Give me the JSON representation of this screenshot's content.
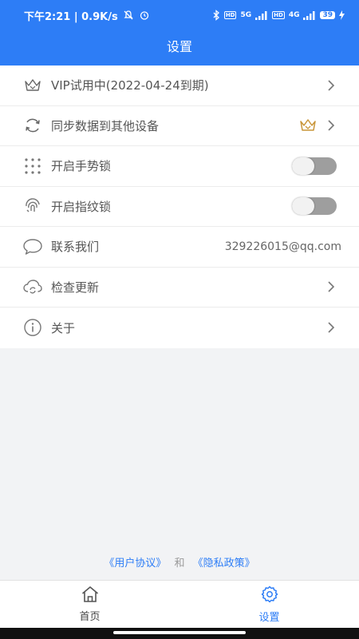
{
  "status_bar": {
    "time_speed": "下午2:21 | 0.9K/s",
    "battery": "39",
    "net1": "5G",
    "net2": "4G",
    "hd": "HD"
  },
  "header": {
    "title": "设置"
  },
  "settings": [
    {
      "label": "VIP试用中(2022-04-24到期)",
      "icon": "crown-icon"
    },
    {
      "label": "同步数据到其他设备",
      "icon": "sync-icon"
    },
    {
      "label": "开启手势锁",
      "icon": "gesture-grid-icon",
      "toggle_on": false
    },
    {
      "label": "开启指纹锁",
      "icon": "fingerprint-icon",
      "toggle_on": false
    },
    {
      "label": "联系我们",
      "icon": "chat-bubble-icon",
      "value": "329226015@qq.com"
    },
    {
      "label": "检查更新",
      "icon": "cloud-refresh-icon"
    },
    {
      "label": "关于",
      "icon": "info-icon"
    }
  ],
  "footer": {
    "user_agreement": "《用户协议》",
    "and": "和",
    "privacy_policy": "《隐私政策》"
  },
  "tabs": [
    {
      "label": "首页",
      "icon": "home-icon"
    },
    {
      "label": "设置",
      "icon": "settings-gear-icon"
    }
  ],
  "colors": {
    "accent": "#2d7df6",
    "crown_gold": "#c9963a",
    "toggle_off": "#9e9e9e"
  }
}
